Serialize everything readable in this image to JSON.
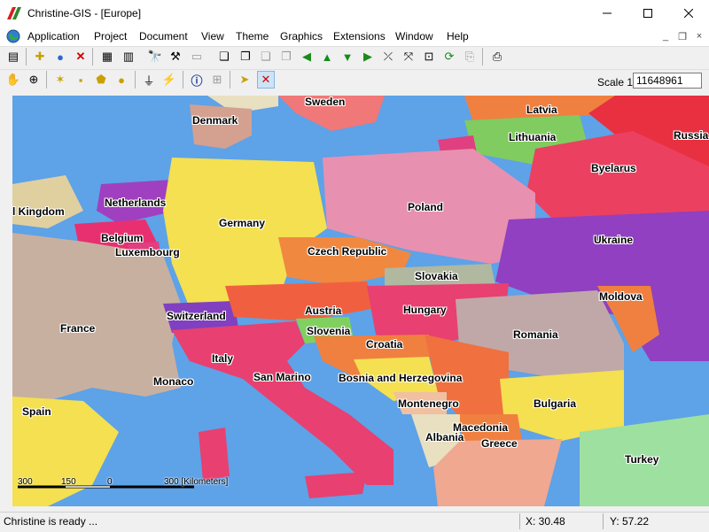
{
  "window": {
    "title": "Christine-GIS - [Europe]",
    "minimize_icon": "minimize-icon",
    "maximize_icon": "maximize-icon",
    "close_icon": "close-icon"
  },
  "menu": {
    "items": [
      "Application",
      "Project",
      "Document",
      "View",
      "Theme",
      "Graphics",
      "Extensions",
      "Window",
      "Help"
    ]
  },
  "toolbar1": {
    "icons": [
      "open-project-icon",
      "add-theme-icon",
      "globe-properties-icon",
      "delete-icon",
      "properties-icon",
      "table-icon",
      "find-icon",
      "hammer-icon",
      "blank-icon",
      "copy-icon",
      "paste-icon",
      "copy-disabled-icon",
      "paste-disabled-icon",
      "move-left-icon",
      "move-up-icon",
      "move-down-icon",
      "move-right-icon",
      "zoom-full-icon",
      "zoom-extent-icon",
      "zoom-active-icon",
      "refresh-icon",
      "export-icon",
      "print-icon"
    ]
  },
  "toolbar2": {
    "icons": [
      "pan-hand-icon",
      "zoom-in-icon",
      "select-icon",
      "select-rect-icon",
      "select-polygon-icon",
      "select-circle-icon",
      "measure-icon",
      "hotlink-icon",
      "info-icon",
      "label-icon",
      "label-pointer-icon",
      "remove-labels-icon"
    ],
    "scale_label": "Scale 1:",
    "scale_value": "11648961"
  },
  "map": {
    "colors": {
      "water": "#5ea2e8",
      "outer_land": "#9ee0a0"
    },
    "labels": {
      "sweden": "Sweden",
      "latvia": "Latvia",
      "denmark": "Denmark",
      "lithuania": "Lithuania",
      "russia": "Russia",
      "byelarus": "Byelarus",
      "united_kingdom": "l Kingdom",
      "netherlands": "Netherlands",
      "poland": "Poland",
      "germany": "Germany",
      "belgium": "Belgium",
      "ukraine": "Ukraine",
      "luxembourg": "Luxembourg",
      "czech_republic": "Czech Republic",
      "slovakia": "Slovakia",
      "moldova": "Moldova",
      "austria": "Austria",
      "hungary": "Hungary",
      "switzerland": "Switzerland",
      "france": "France",
      "slovenia": "Slovenia",
      "romania": "Romania",
      "croatia": "Croatia",
      "italy": "Italy",
      "monaco": "Monaco",
      "san_marino": "San Marino",
      "bosnia": "Bosnia and Herzegovina",
      "bulgaria": "Bulgaria",
      "montenegro": "Montenegro",
      "spain": "Spain",
      "macedonia": "Macedonia",
      "albania": "Albania",
      "greece": "Greece",
      "turkey": "Turkey"
    },
    "scalebar": {
      "tick1": "300",
      "tick2": "150",
      "tick3": "0",
      "tick4": "300 [Kilometers]"
    }
  },
  "status": {
    "message": "Christine is ready ...",
    "x": "X: 30.48",
    "y": "Y: 57.22"
  }
}
